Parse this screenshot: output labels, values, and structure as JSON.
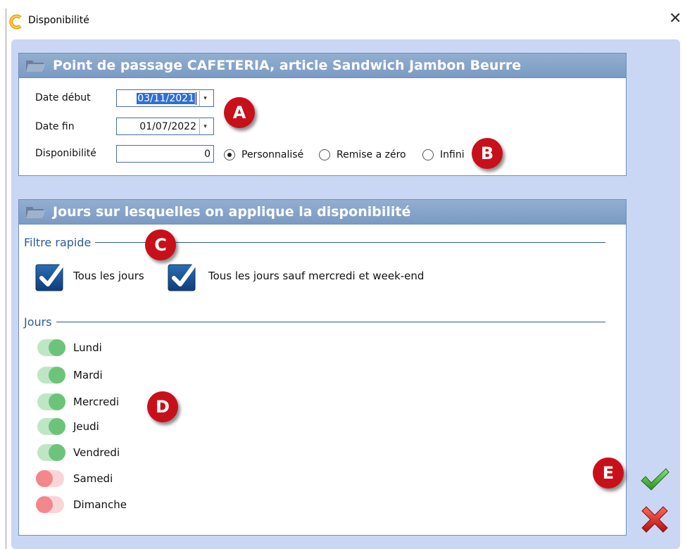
{
  "window": {
    "title": "Disponibilité",
    "close_glyph": "✕"
  },
  "point_panel": {
    "title": "Point de passage CAFETERIA, article Sandwich Jambon Beurre",
    "date_debut_label": "Date début",
    "date_debut_value": "03/11/2021",
    "date_fin_label": "Date fin",
    "date_fin_value": "01/07/2022",
    "disponibilite_label": "Disponibilité",
    "disponibilite_value": "0",
    "options": [
      {
        "label": "Personnalisé",
        "selected": true
      },
      {
        "label": "Remise a zéro",
        "selected": false
      },
      {
        "label": "Infini",
        "selected": false
      }
    ],
    "dropdown_glyph": "▾"
  },
  "jours_panel": {
    "title": "Jours sur lesquelles on applique la disponibilité",
    "filtre_rapide_title": "Filtre rapide",
    "quick_filters": [
      {
        "label": "Tous les jours"
      },
      {
        "label": "Tous les jours sauf mercredi et week-end"
      }
    ],
    "jours_title": "Jours",
    "days": [
      {
        "label": "Lundi",
        "on": true
      },
      {
        "label": "Mardi",
        "on": true
      },
      {
        "label": "Mercredi",
        "on": true
      },
      {
        "label": "Jeudi",
        "on": true
      },
      {
        "label": "Vendredi",
        "on": true
      },
      {
        "label": "Samedi",
        "on": false
      },
      {
        "label": "Dimanche",
        "on": false
      }
    ]
  },
  "annotations": [
    "A",
    "B",
    "C",
    "D",
    "E"
  ],
  "colors": {
    "client_bg": "#c9d7f4",
    "header_bg": "#7b9bc4",
    "section_title": "#2b5d9a",
    "toggle_on": "#6bc47a",
    "toggle_off": "#f2878c",
    "badge": "#c8101a",
    "validate": "#3faa2f",
    "cancel": "#d31a1a"
  },
  "icons": {
    "app": "cafeteria-app-icon",
    "panel_header": "folder-icon",
    "quick_filter": "check-square-icon",
    "validate": "check-icon",
    "cancel": "close-icon"
  }
}
